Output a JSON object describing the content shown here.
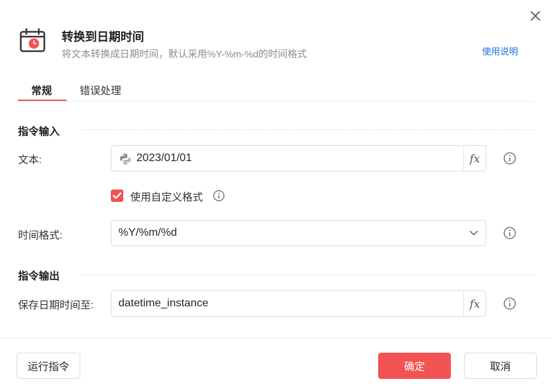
{
  "dialog": {
    "title": "转换到日期时间",
    "subtitle": "将文本转换成日期时间，默认采用%Y-%m-%d的时间格式",
    "help_link": "使用说明",
    "close_icon": "close-icon",
    "header_icon": "calendar-clock-icon"
  },
  "tabs": [
    {
      "label": "常规",
      "active": true
    },
    {
      "label": "错误处理",
      "active": false
    }
  ],
  "input_section": {
    "title": "指令输入",
    "text_field": {
      "label": "文本:",
      "value": "2023/01/01",
      "icon": "python-icon",
      "fx_label": "fx"
    },
    "custom_format": {
      "label": "使用自定义格式",
      "checked": true
    },
    "format_field": {
      "label": "时间格式:",
      "value": "%Y/%m/%d"
    }
  },
  "output_section": {
    "title": "指令输出",
    "save_field": {
      "label": "保存日期时间至:",
      "value": "datetime_instance",
      "fx_label": "fx"
    }
  },
  "footer": {
    "run_label": "运行指令",
    "ok_label": "确定",
    "cancel_label": "取消"
  },
  "colors": {
    "accent": "#f25454",
    "link": "#1677d8"
  }
}
